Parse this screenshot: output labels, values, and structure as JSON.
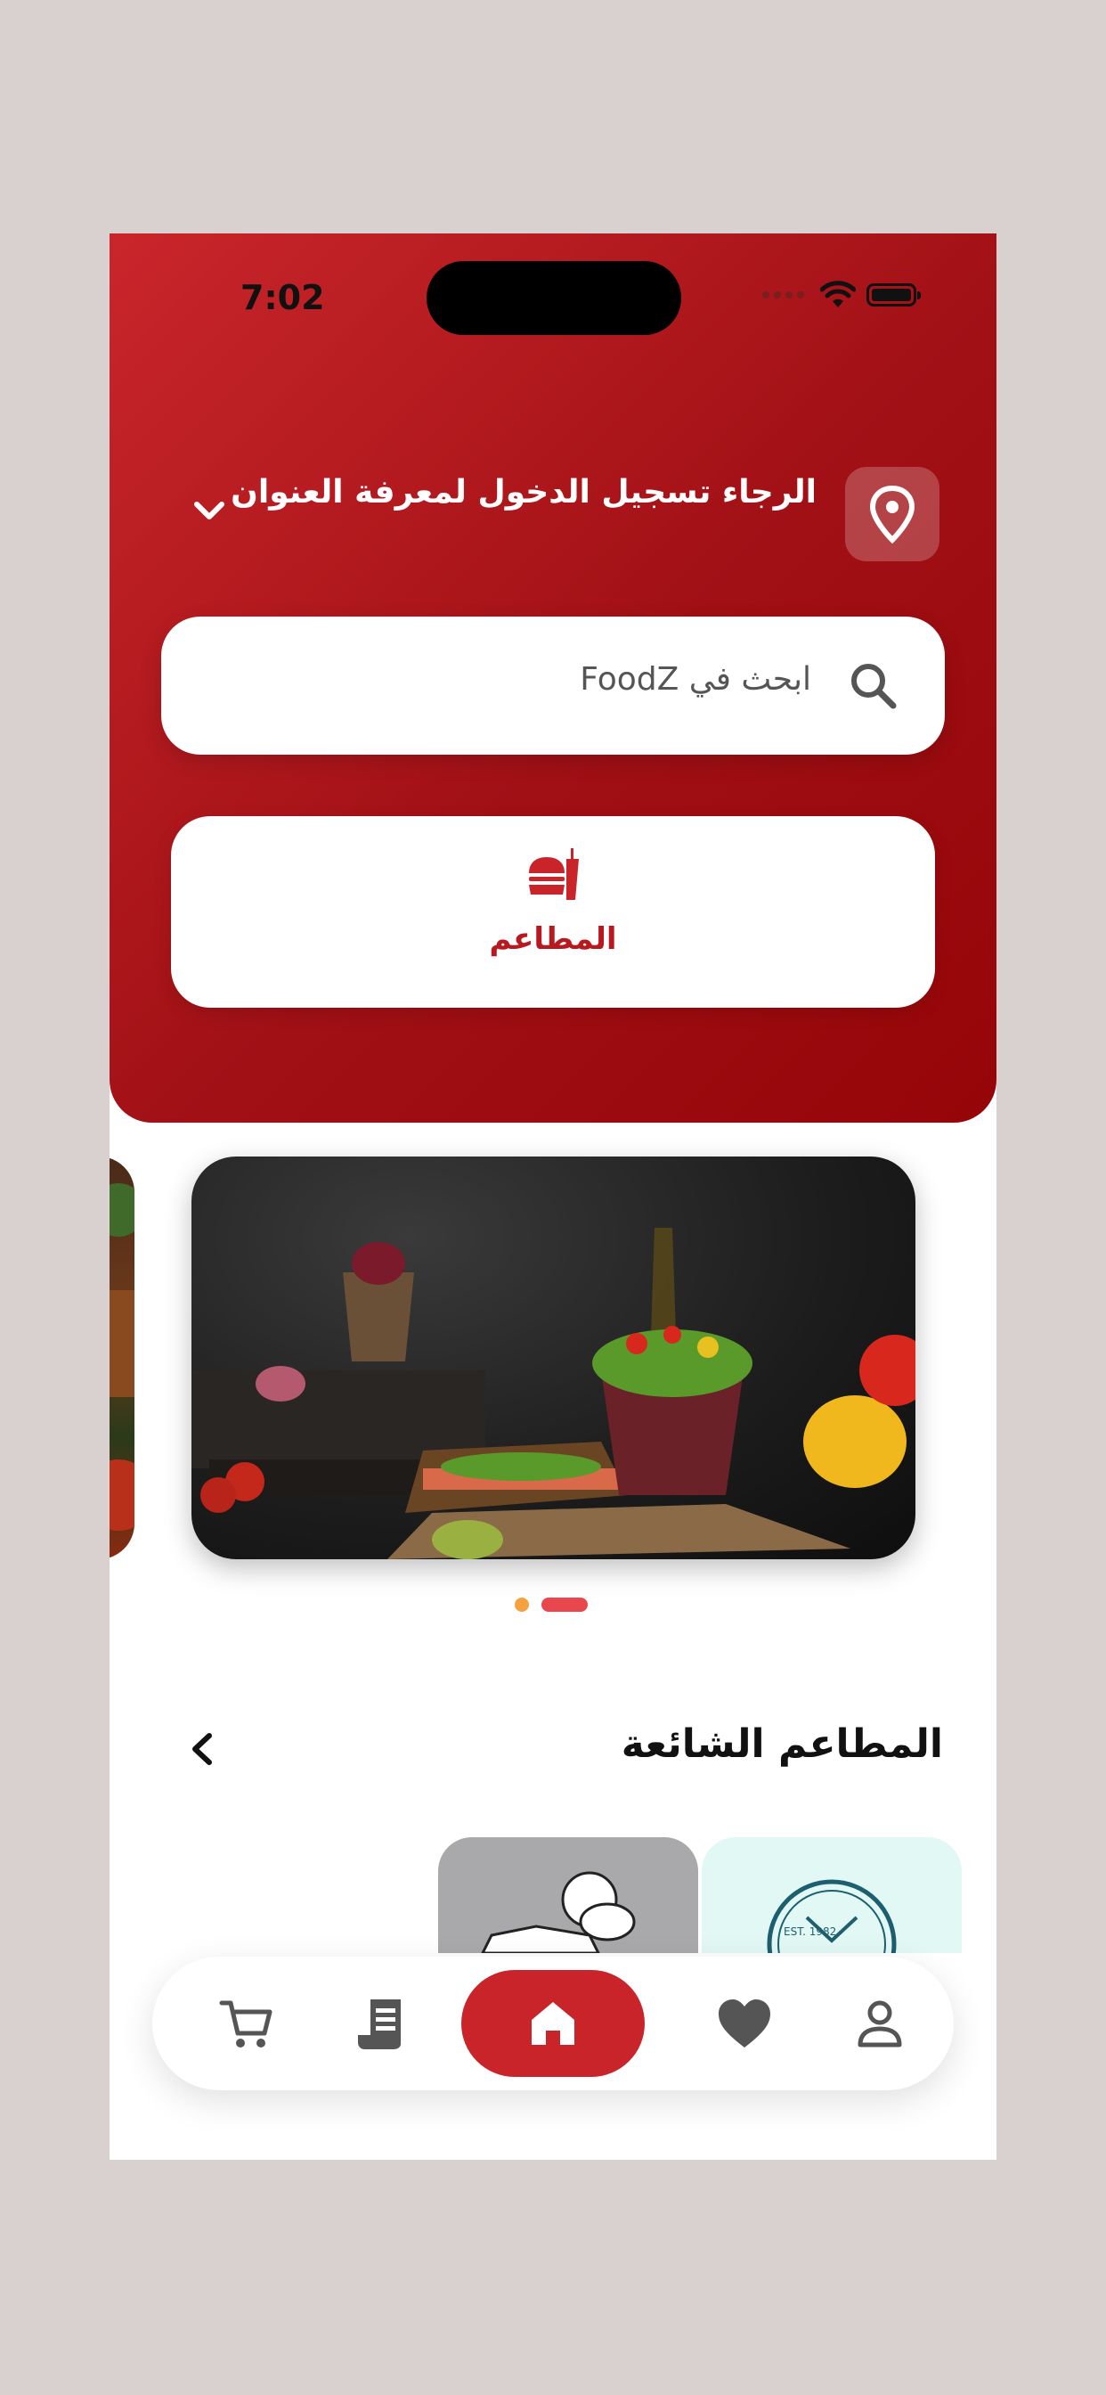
{
  "status_bar": {
    "time": "7:02"
  },
  "header": {
    "location_text": "الرجاء تسجيل الدخول لمعرفة العنوان",
    "search": {
      "placeholder": "ابحث في FoodZ"
    },
    "category": {
      "label": "المطاعم",
      "icon": "restaurant-icon"
    }
  },
  "banner": {
    "pages": 2,
    "active_page": 2
  },
  "popular": {
    "title": "المطاعم الشائعة",
    "badge_text": "EST. 1982"
  },
  "bottom_nav": {
    "items": [
      {
        "name": "cart",
        "icon": "cart-icon"
      },
      {
        "name": "orders",
        "icon": "receipt-icon"
      },
      {
        "name": "home",
        "icon": "home-icon",
        "active": true
      },
      {
        "name": "favorites",
        "icon": "heart-icon"
      },
      {
        "name": "profile",
        "icon": "profile-icon"
      }
    ]
  },
  "colors": {
    "brand": "#c8242a",
    "accent": "#f5a13f"
  }
}
